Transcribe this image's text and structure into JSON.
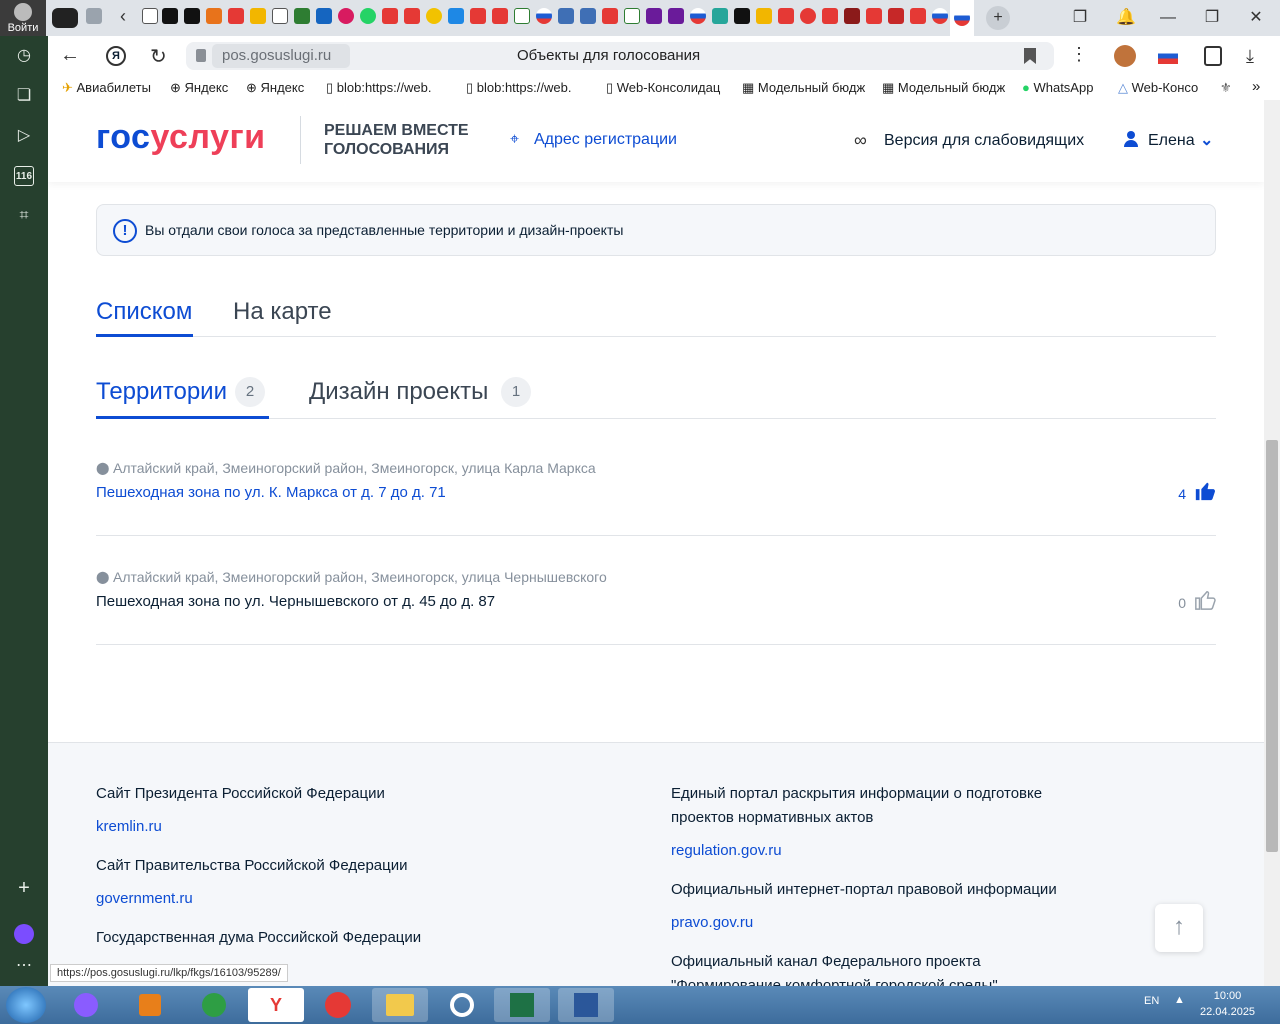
{
  "browser": {
    "login_label": "Войти",
    "url_host": "pos.gosuslugi.ru",
    "page_title": "Объекты для голосования",
    "bookmarks": [
      "Авиабилеты",
      "Яндекс",
      "Яндекс",
      "blob:https://web.",
      "blob:https://web.",
      "Web-Консолидац",
      "Модельный бюдж",
      "Модельный бюдж",
      "WhatsApp",
      "Web-Консо"
    ],
    "more_label": "»",
    "status_url": "https://pos.gosuslugi.ru/lkp/fkgs/16103/95289/"
  },
  "header": {
    "logo_part1": "гос",
    "logo_part2": "услуги",
    "slogan": "РЕШАЕМ ВМЕСТЕ ГОЛОСОВАНИЯ",
    "address_link": "Адрес регистрации",
    "vision_link": "Версия для слабовидящих",
    "user_name": "Елена"
  },
  "info": {
    "message": "Вы отдали свои голоса за представленные территории и дизайн-проекты",
    "icon_glyph": "!"
  },
  "view_tabs": [
    "Списком",
    "На карте"
  ],
  "category_tabs": [
    {
      "label": "Территории",
      "count": "2"
    },
    {
      "label": "Дизайн проекты",
      "count": "1"
    }
  ],
  "items": [
    {
      "location": "Алтайский край, Змеиногорский район, Змеиногорск, улица Карла Маркса",
      "title": "Пешеходная зона по ул. К. Маркса от д. 7 до д. 71",
      "likes": "4",
      "liked": true
    },
    {
      "location": "Алтайский край, Змеиногорский район, Змеиногорск, улица Чернышевского",
      "title": "Пешеходная зона по ул. Чернышевского от д. 45 до д. 87",
      "likes": "0",
      "liked": false
    }
  ],
  "footer": {
    "left": [
      {
        "heading": "Сайт Президента Российской Федерации",
        "link": "kremlin.ru"
      },
      {
        "heading": "Сайт Правительства Российской Федерации",
        "link": "government.ru"
      },
      {
        "heading": "Государственная дума Российской Федерации",
        "link": ""
      }
    ],
    "right": [
      {
        "heading": "Единый портал раскрытия информации о подготовке проектов нормативных актов",
        "link": "regulation.gov.ru"
      },
      {
        "heading": "Официальный интернет-портал правовой информации",
        "link": "pravo.gov.ru"
      },
      {
        "heading": "Официальный канал Федерального проекта \"Формирование комфортной городской среды\"",
        "link": ""
      }
    ],
    "to_top_glyph": "↑"
  },
  "taskbar": {
    "lang": "EN",
    "time": "10:00",
    "date": "22.04.2025"
  },
  "colors": {
    "brand_blue": "#0d4cd3",
    "brand_red": "#ee3f58",
    "text_dark": "#0b1f33",
    "muted": "#86909c"
  }
}
